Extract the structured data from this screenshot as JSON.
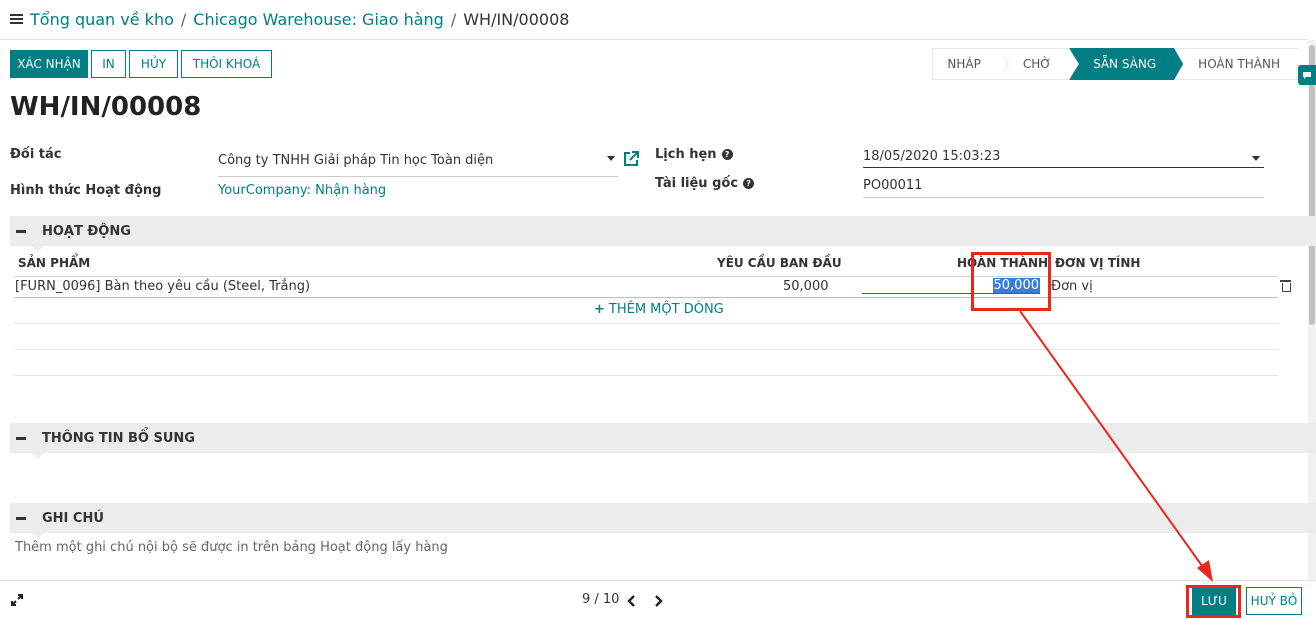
{
  "breadcrumb": {
    "items": [
      "Tổng quan về kho",
      "Chicago Warehouse: Giao hàng"
    ],
    "current": "WH/IN/00008"
  },
  "actions": {
    "confirm": "XÁC NHẬN",
    "print": "IN",
    "cancel": "HỦY",
    "unreserve": "THÔI KHOÁ"
  },
  "statusbar": {
    "stages": [
      "NHÁP",
      "CHỜ",
      "SẴN SÀNG",
      "HOÀN THÀNH"
    ],
    "active": "SẴN SÀNG"
  },
  "record": {
    "title": "WH/IN/00008",
    "partner_label": "Đối tác",
    "partner_value": "Công ty TNHH Giải pháp Tin học Toàn diện",
    "op_type_label": "Hình thức Hoạt động",
    "op_type_value": "YourCompany: Nhận hàng",
    "scheduled_label": "Lịch hẹn",
    "scheduled_value": "18/05/2020 15:03:23",
    "origin_label": "Tài liệu gốc",
    "origin_value": "PO00011"
  },
  "sections": {
    "operations": "HOẠT ĐỘNG",
    "additional": "THÔNG TIN BỔ SUNG",
    "notes": "GHI CHÚ"
  },
  "table": {
    "headers": {
      "product": "SẢN PHẨM",
      "demand": "YÊU CẦU BAN ĐẦU",
      "done": "HOÀN THÀNH",
      "uom": "ĐƠN VỊ TÍNH"
    },
    "rows": [
      {
        "product": "[FURN_0096] Bàn theo yêu cầu (Steel, Trắng)",
        "demand": "50,000",
        "done": "50,000",
        "uom": "Đơn vị"
      }
    ],
    "add_line": "THÊM MỘT DÒNG"
  },
  "notes": {
    "placeholder": "Thêm một ghi chú nội bộ sẽ được in trên bảng Hoạt động lấy hàng"
  },
  "pager": {
    "text": "9 / 10"
  },
  "footer": {
    "save": "LƯU",
    "discard": "HUỶ BỎ"
  },
  "colors": {
    "primary": "#017e84",
    "annotation": "#e8281e",
    "selection": "#3a7dd8"
  }
}
